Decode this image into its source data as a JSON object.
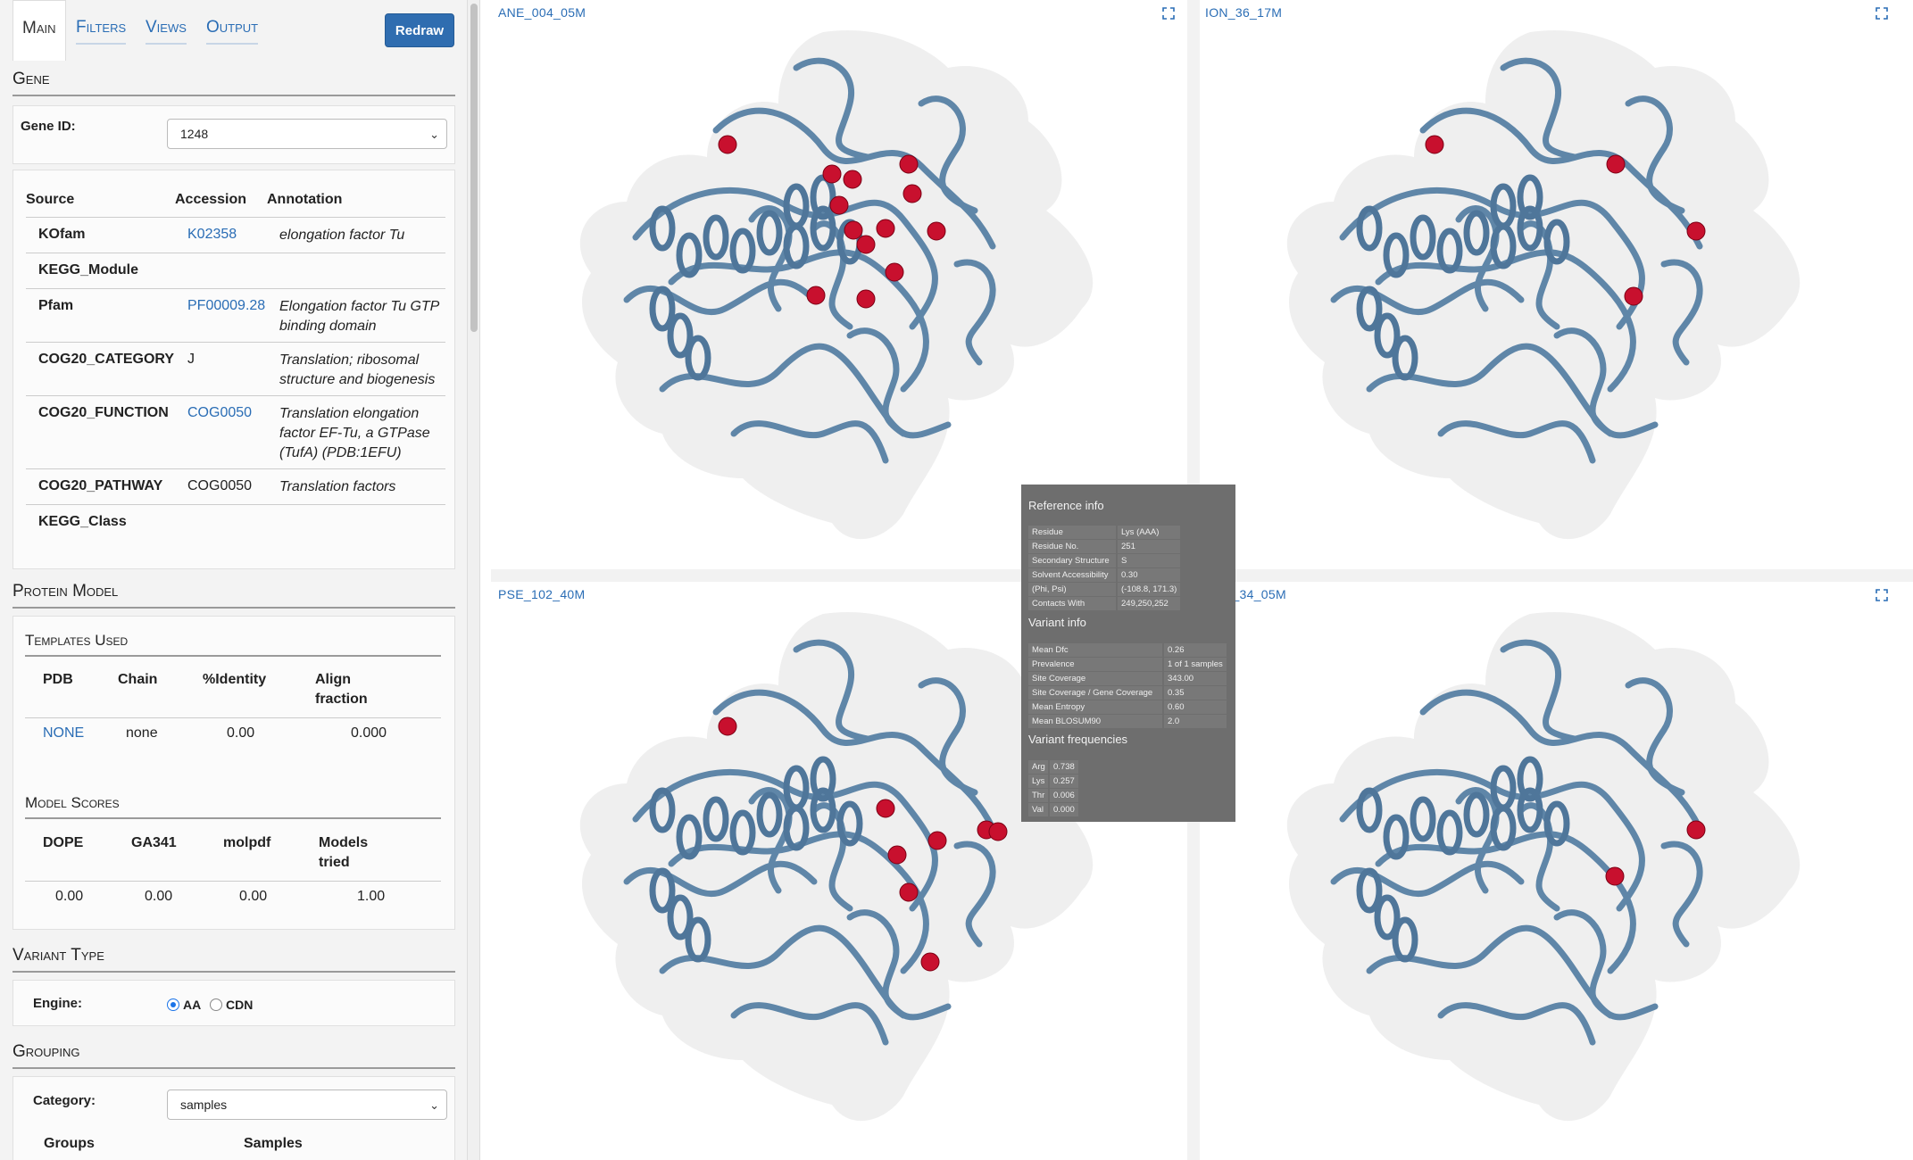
{
  "tabs": [
    {
      "label": "Main"
    },
    {
      "label": "Filters"
    },
    {
      "label": "Views"
    },
    {
      "label": "Output"
    }
  ],
  "redraw_label": "Redraw",
  "gene": {
    "section_title": "Gene",
    "id_label": "Gene ID:",
    "id_value": "1248"
  },
  "annotations": {
    "headers": {
      "source": "Source",
      "accession": "Accession",
      "annotation": "Annotation"
    },
    "rows": [
      {
        "source": "KOfam",
        "accession": "K02358",
        "annotation": "elongation factor Tu"
      },
      {
        "source": "KEGG_Module",
        "accession": "",
        "annotation": ""
      },
      {
        "source": "Pfam",
        "accession": "PF00009.28",
        "annotation": "Elongation factor Tu GTP binding domain"
      },
      {
        "source": "COG20_CATEGORY",
        "accession": "J",
        "annotation": "Translation; ribosomal structure and biogenesis"
      },
      {
        "source": "COG20_FUNCTION",
        "accession": "COG0050",
        "annotation": "Translation elongation factor EF-Tu, a GTPase (TufA) (PDB:1EFU)"
      },
      {
        "source": "COG20_PATHWAY",
        "accession": "COG0050",
        "annotation": "Translation factors"
      },
      {
        "source": "KEGG_Class",
        "accession": "",
        "annotation": ""
      }
    ]
  },
  "protein_model": {
    "section_title": "Protein Model",
    "templates_title": "Templates Used",
    "templates_headers": {
      "pdb": "PDB",
      "chain": "Chain",
      "identity": "%Identity",
      "align": "Align fraction"
    },
    "templates_row": {
      "pdb": "NONE",
      "chain": "none",
      "identity": "0.00",
      "align": "0.000"
    },
    "scores_title": "Model Scores",
    "scores_headers": {
      "dope": "DOPE",
      "ga341": "GA341",
      "molpdf": "molpdf",
      "models": "Models tried"
    },
    "scores_row": {
      "dope": "0.00",
      "ga341": "0.00",
      "molpdf": "0.00",
      "models": "1.00"
    }
  },
  "variant_type": {
    "section_title": "Variant Type",
    "engine_label": "Engine:",
    "options": [
      "AA",
      "CDN"
    ],
    "selected": "AA"
  },
  "grouping": {
    "section_title": "Grouping",
    "category_label": "Category:",
    "category_value": "samples",
    "groups_header": "Groups",
    "samples_header": "Samples"
  },
  "views": [
    {
      "title": "ANE_004_05M"
    },
    {
      "title": "ION_36_17M"
    },
    {
      "title": "PSE_102_40M"
    },
    {
      "title": "RED_34_05M"
    }
  ],
  "tooltip": {
    "reference_title": "Reference info",
    "reference": [
      {
        "k": "Residue",
        "v": "Lys (AAA)"
      },
      {
        "k": "Residue No.",
        "v": "251"
      },
      {
        "k": "Secondary Structure",
        "v": "S"
      },
      {
        "k": "Solvent Accessibility",
        "v": "0.30"
      },
      {
        "k": "(Phi, Psi)",
        "v": "(-108.8, 171.3)"
      },
      {
        "k": "Contacts With",
        "v": "249,250,252"
      }
    ],
    "variant_title": "Variant info",
    "variant": [
      {
        "k": "Mean Dfc",
        "v": "0.26"
      },
      {
        "k": "Prevalence",
        "v": "1 of 1 samples"
      },
      {
        "k": "Site Coverage",
        "v": "343.00"
      },
      {
        "k": "Site Coverage / Gene Coverage",
        "v": "0.35"
      },
      {
        "k": "Mean Entropy",
        "v": "0.60"
      },
      {
        "k": "Mean BLOSUM90",
        "v": "2.0"
      }
    ],
    "freq_title": "Variant frequencies",
    "frequencies": [
      {
        "k": "Arg",
        "v": "0.738"
      },
      {
        "k": "Lys",
        "v": "0.257"
      },
      {
        "k": "Thr",
        "v": "0.006"
      },
      {
        "k": "Val",
        "v": "0.000"
      }
    ]
  },
  "colors": {
    "accent": "#2f6db0",
    "link": "#2a6db5",
    "ribbon": "#5f86a8",
    "variant_sphere": "#c8102e",
    "tooltip_bg": "#6e6e6e"
  }
}
